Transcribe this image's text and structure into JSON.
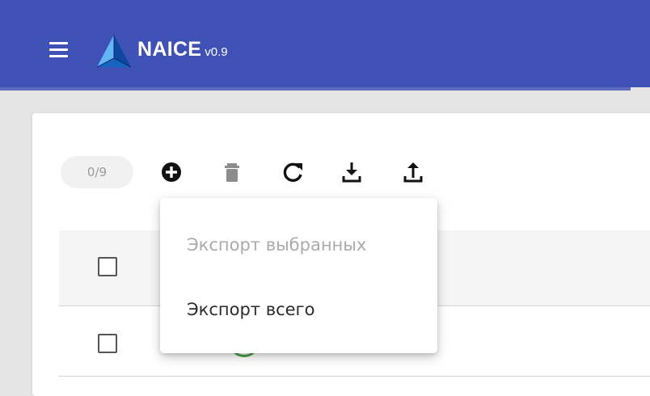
{
  "app": {
    "name": "NAICE",
    "version": "v0.9",
    "brand_color": "#3f51b5"
  },
  "toolbar": {
    "selection_counter": "0/9",
    "icons": [
      "add-circle-icon",
      "delete-icon",
      "refresh-icon",
      "download-icon",
      "upload-icon"
    ]
  },
  "export_menu": {
    "items": [
      {
        "label": "Экспорт выбранных",
        "disabled": true
      },
      {
        "label": "Экспорт всего",
        "disabled": false
      }
    ]
  },
  "table": {
    "rows": [
      {
        "selected": false,
        "status": "ok"
      }
    ]
  }
}
